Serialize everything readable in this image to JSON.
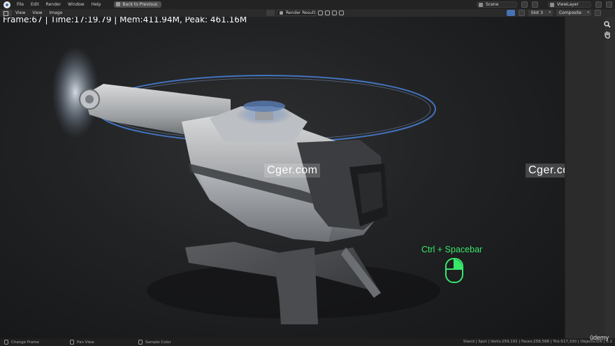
{
  "menubar": {
    "items": [
      "File",
      "Edit",
      "Render",
      "Window",
      "Help"
    ],
    "back_button": "Back to Previous",
    "scene": "Scene",
    "view_layer": "ViewLayer"
  },
  "editor_header": {
    "menus": [
      "View",
      "View",
      "Image"
    ],
    "image_name": "Render Result",
    "slot": "Slot 3",
    "pass": "Composite"
  },
  "render_info": "Frame:67 | Time:17:19.79 | Mem:411.94M, Peak: 461.16M",
  "watermarks": [
    "Cger.com",
    "Cger.com"
  ],
  "shortcut_overlay": "Ctrl + Spacebar",
  "statusbar": {
    "items": [
      "Change Frame",
      "Pan View",
      "Sample Color"
    ],
    "stats": "Stand | Spot | Verts:259,191 | Faces:258,588 | Tris:517,330 | Objects:0/6 | 3.2"
  },
  "brand": "ûdemy",
  "colors": {
    "accent_blue": "#4772b3",
    "shortcut_green": "#38e66a",
    "rotor_glow": "#4d8df0"
  },
  "icons": {
    "blender_logo": "blender-logo-icon",
    "zoom": "magnifier-icon",
    "pan": "hand-icon",
    "mouse": "mouse-icon"
  }
}
